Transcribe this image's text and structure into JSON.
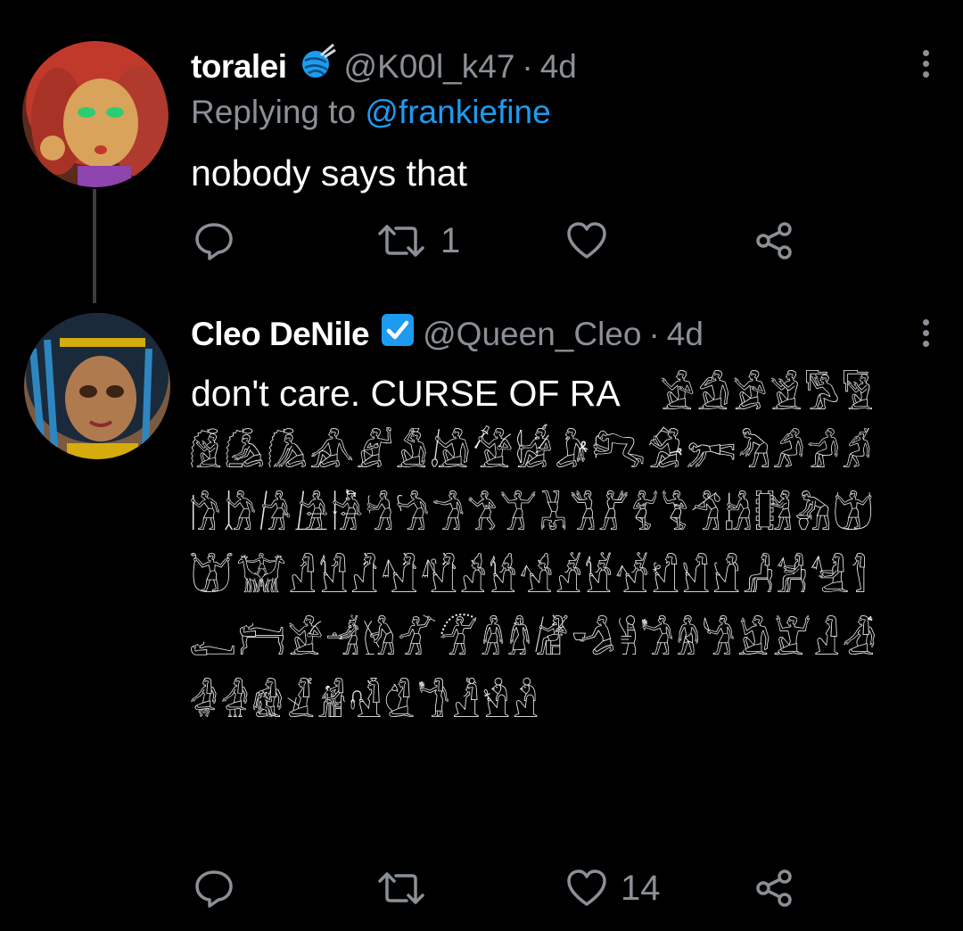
{
  "tweets": [
    {
      "name": "toralei",
      "badge_icon": "yarn-ball-icon",
      "handle": "@K00l_k47",
      "separator": "·",
      "time": "4d",
      "reply_prefix": "Replying to",
      "reply_to": "@frankiefine",
      "text": "nobody says that",
      "actions": {
        "reply_count": "",
        "retweet_count": "1",
        "like_count": ""
      }
    },
    {
      "name": "Cleo DeNile",
      "badge_icon": "verified-check-icon",
      "handle": "@Queen_Cleo",
      "separator": "·",
      "time": "4d",
      "text": "don't care. CURSE OF RA",
      "glyphs_first_line": "𓀀𓀁𓀂𓀃𓀄𓀅",
      "glyphs_rest": "𓀆𓀇𓀈𓀉𓀊𓀋𓀌𓀍𓀎𓀏𓀐𓀑𓀒𓀓𓀔𓀕𓀖𓀗𓀘𓀙𓀚𓀛𓀜𓀝𓀞𓀟𓀠𓀡𓀢𓀣𓀤𓀥𓀦𓀧𓀨𓀩𓀪𓀫𓀬𓀭𓀮𓀯𓀰𓀱𓀲𓀳𓀴𓀵𓀶𓀷𓀸𓀹𓀺𓀻𓀼𓀽𓀾𓀿𓁀𓁁𓁂𓁃𓁄𓁅𓁆𓁇𓁈𓁉𓁊𓁋𓁌𓁍𓁎𓁏𓁐𓁑𓁒𓁓𓁔𓁕𓁖𓁗𓁘𓁙𓁚𓁛𓁜",
      "actions": {
        "reply_count": "",
        "retweet_count": "",
        "like_count": "14"
      }
    }
  ],
  "colors": {
    "background": "#000000",
    "muted": "#8b9096",
    "link": "#1d9bf0",
    "verified": "#1d9bf0"
  }
}
